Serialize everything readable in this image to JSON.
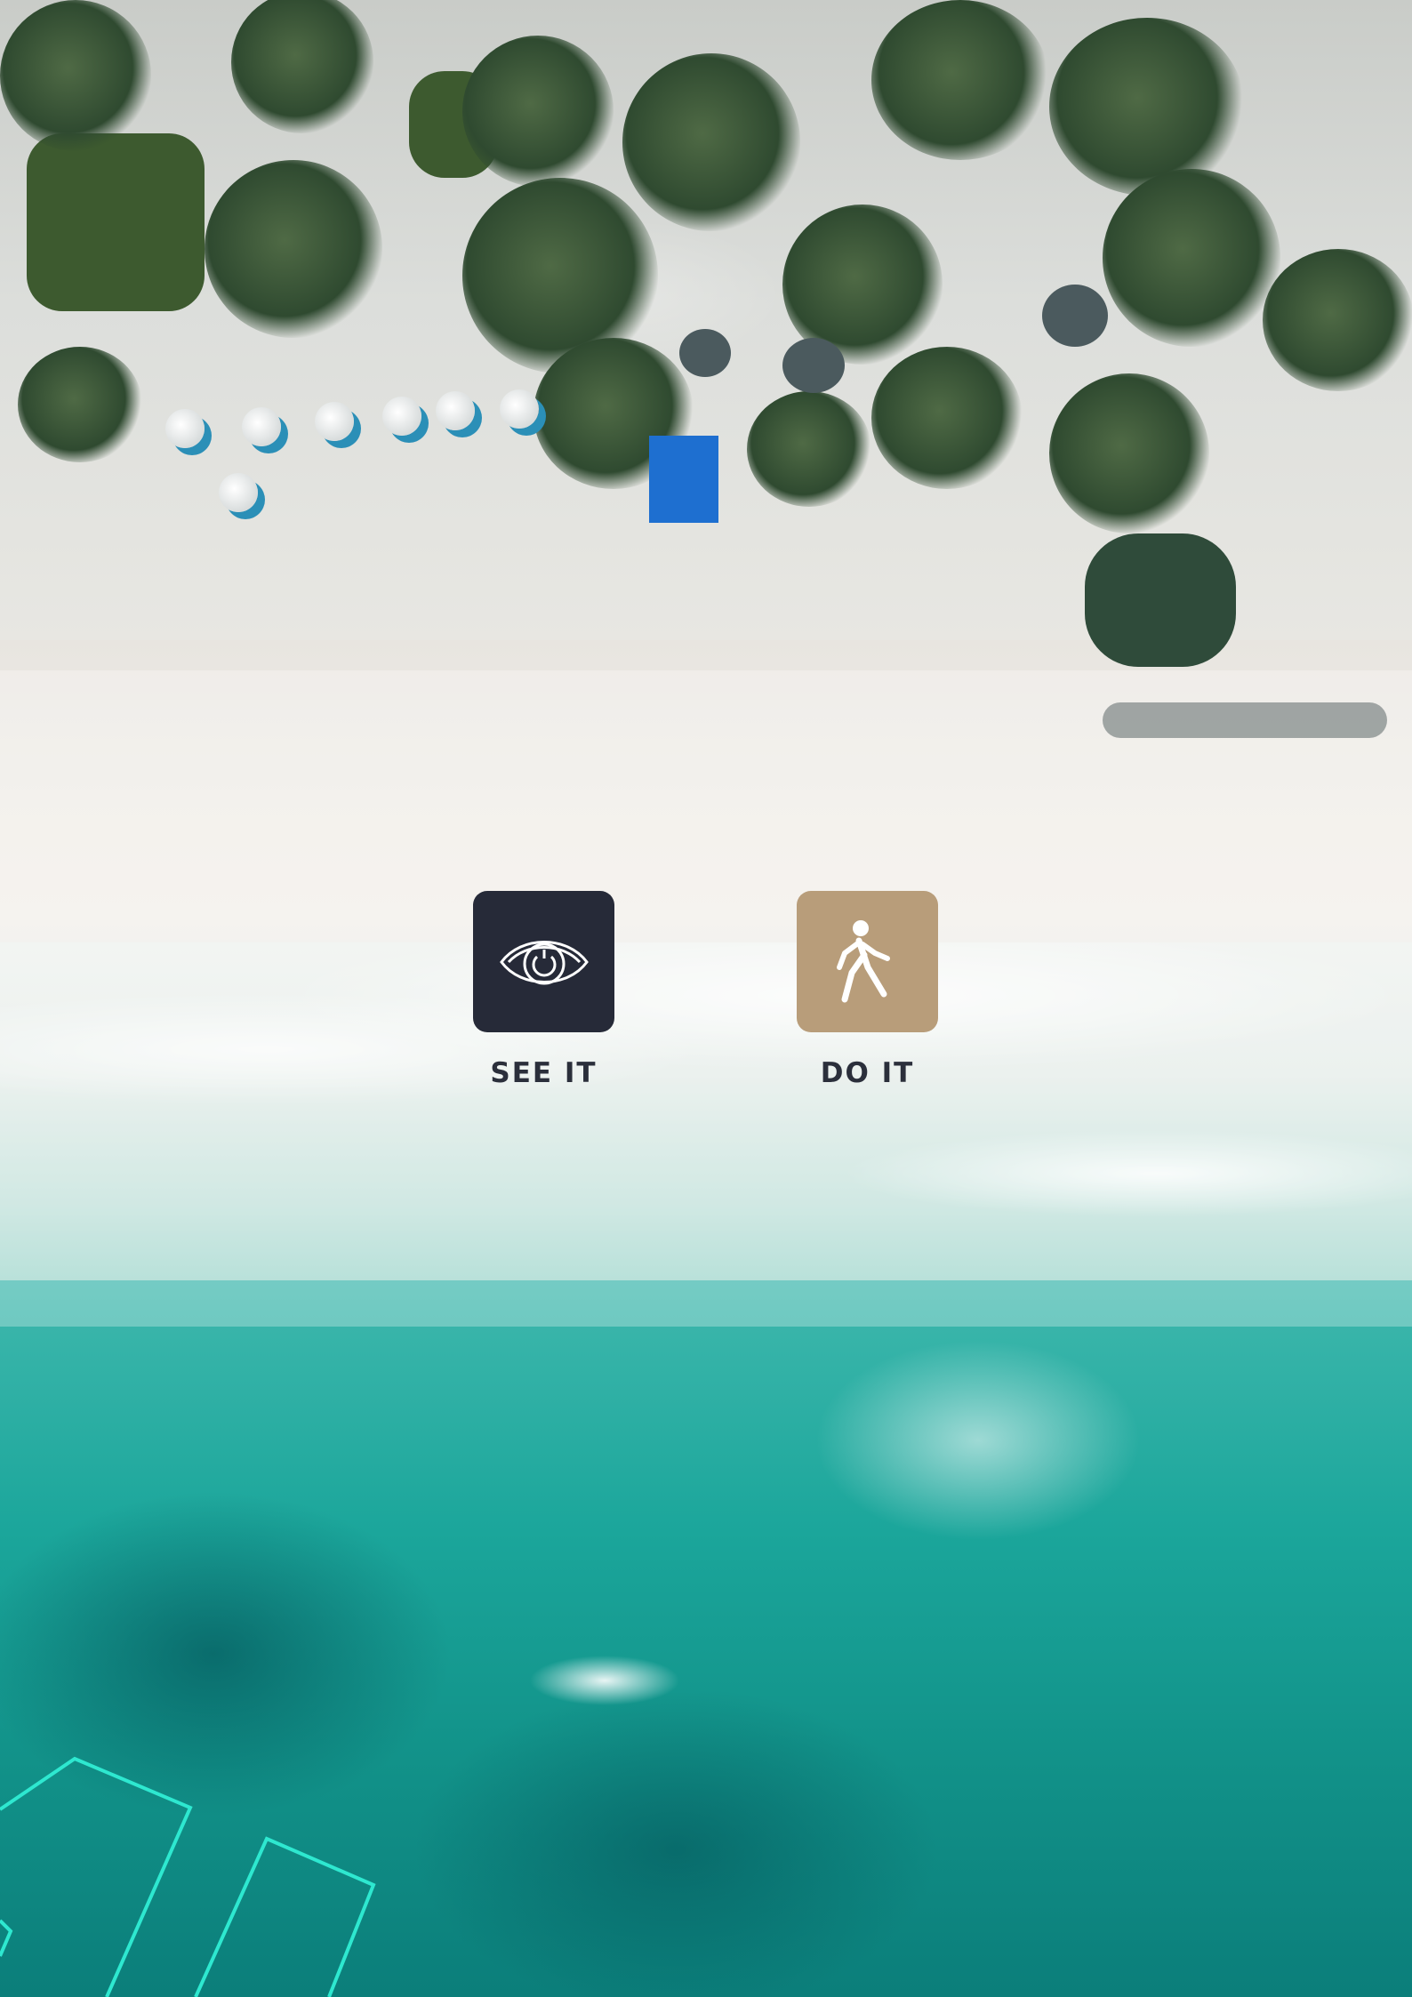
{
  "background": {
    "description_icon": "aerial-beach-photo",
    "accent_line_color": "#2ee8d0"
  },
  "actions": [
    {
      "label": "SEE IT",
      "icon": "eye-icon",
      "tile_color": "#262a38"
    },
    {
      "label": "DO IT",
      "icon": "walking-person-icon",
      "tile_color": "#b89d7a"
    }
  ]
}
